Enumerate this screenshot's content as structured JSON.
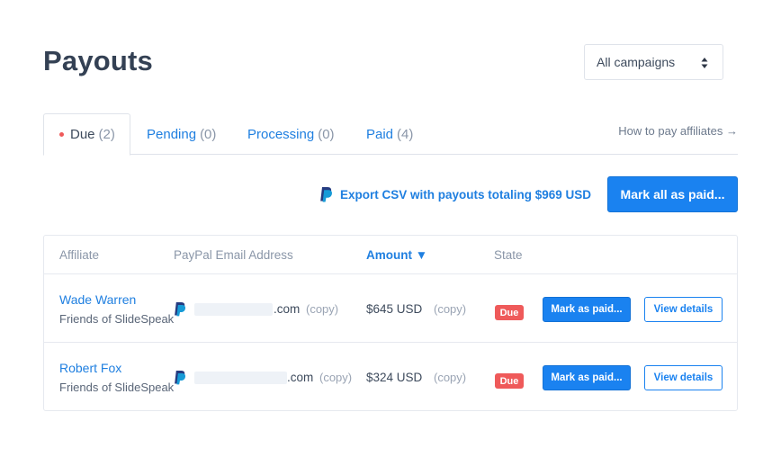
{
  "page": {
    "title": "Payouts"
  },
  "campaign_select": {
    "value": "All campaigns",
    "icon": "updown-arrows-icon"
  },
  "tabs": [
    {
      "label": "Due",
      "count": "(2)",
      "active": true
    },
    {
      "label": "Pending",
      "count": "(0)",
      "active": false
    },
    {
      "label": "Processing",
      "count": "(0)",
      "active": false
    },
    {
      "label": "Paid",
      "count": "(4)",
      "active": false
    }
  ],
  "how_to_link": "How to pay affiliates →",
  "export": {
    "label": "Export CSV with payouts totaling $969 USD",
    "icon": "paypal-icon"
  },
  "mark_all_label": "Mark all as paid...",
  "table": {
    "headers": {
      "affiliate": "Affiliate",
      "email": "PayPal Email Address",
      "amount": "Amount ▼",
      "state": "State"
    },
    "rows": [
      {
        "name": "Wade Warren",
        "org": "Friends of SlideSpeak",
        "email_suffix": ".com",
        "email_copy": "(copy)",
        "amount": "$645 USD",
        "amount_copy": "(copy)",
        "state": "Due",
        "mark_label": "Mark as paid...",
        "view_label": "View details"
      },
      {
        "name": "Robert Fox",
        "org": "Friends of SlideSpeak",
        "email_suffix": ".com",
        "email_copy": "(copy)",
        "amount": "$324 USD",
        "amount_copy": "(copy)",
        "state": "Due",
        "mark_label": "Mark as paid...",
        "view_label": "View details"
      }
    ]
  },
  "colors": {
    "accent": "#1a82f0",
    "due_badge": "#ef5a5a",
    "title": "#344154"
  }
}
